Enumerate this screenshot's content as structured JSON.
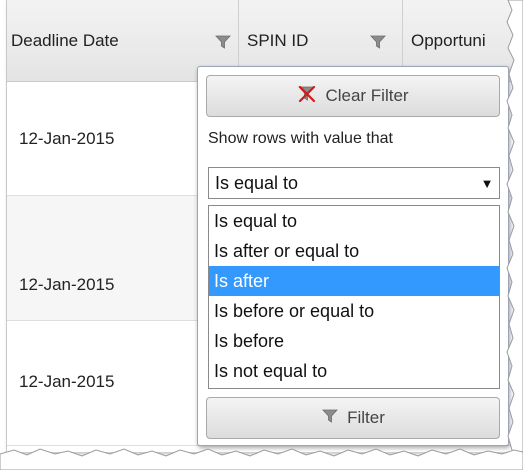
{
  "grid": {
    "columns": [
      {
        "label": "Deadline Date",
        "filter_icon": "funnel-icon"
      },
      {
        "label": "SPIN ID",
        "filter_icon": "funnel-icon"
      },
      {
        "label": "Opportuni",
        "filter_icon": null
      }
    ],
    "rows": [
      {
        "deadline_date": "12-Jan-2015"
      },
      {
        "deadline_date": "12-Jan-2015"
      },
      {
        "deadline_date": "12-Jan-2015"
      }
    ]
  },
  "filter_popup": {
    "clear_filter_label": "Clear Filter",
    "clear_filter_icon": "clear-filter-icon",
    "caption": "Show rows with value that",
    "operator_select": {
      "selected_value": "Is equal to",
      "options": [
        "Is equal to",
        "Is after or equal to",
        "Is after",
        "Is before or equal to",
        "Is before",
        "Is not equal to"
      ],
      "highlighted_option": "Is after"
    },
    "filter_label": "Filter",
    "filter_icon": "funnel-icon"
  },
  "colors": {
    "highlight": "#3399ff",
    "header_bg": "#e8e8e8",
    "popup_border": "#9aa5b8"
  }
}
